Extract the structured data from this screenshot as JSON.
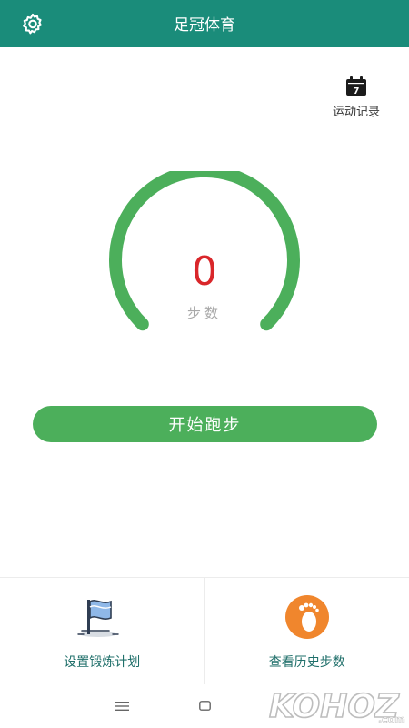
{
  "header": {
    "title": "足冠体育",
    "settings_icon": "gear-icon"
  },
  "record": {
    "label": "运动记录",
    "calendar_day": "7",
    "icon": "calendar-icon"
  },
  "gauge": {
    "steps_value": "0",
    "steps_label": "步数",
    "progress_fraction": 0,
    "colors": {
      "arc": "#4caf5b",
      "value": "#d9262a"
    }
  },
  "actions": {
    "start_button": "开始跑步"
  },
  "bottom": {
    "plan_label": "设置锻炼计划",
    "plan_icon": "flag-icon",
    "history_label": "查看历史步数",
    "history_icon": "footprint-icon"
  },
  "navbar": {
    "menu_icon": "menu-icon",
    "home_icon": "home-square-icon"
  },
  "watermark": {
    "text": "KOHOZ",
    "suffix": ".com"
  },
  "colors": {
    "header": "#1a8c7a",
    "button": "#4caf5b",
    "footprint_bg": "#f0862d"
  }
}
